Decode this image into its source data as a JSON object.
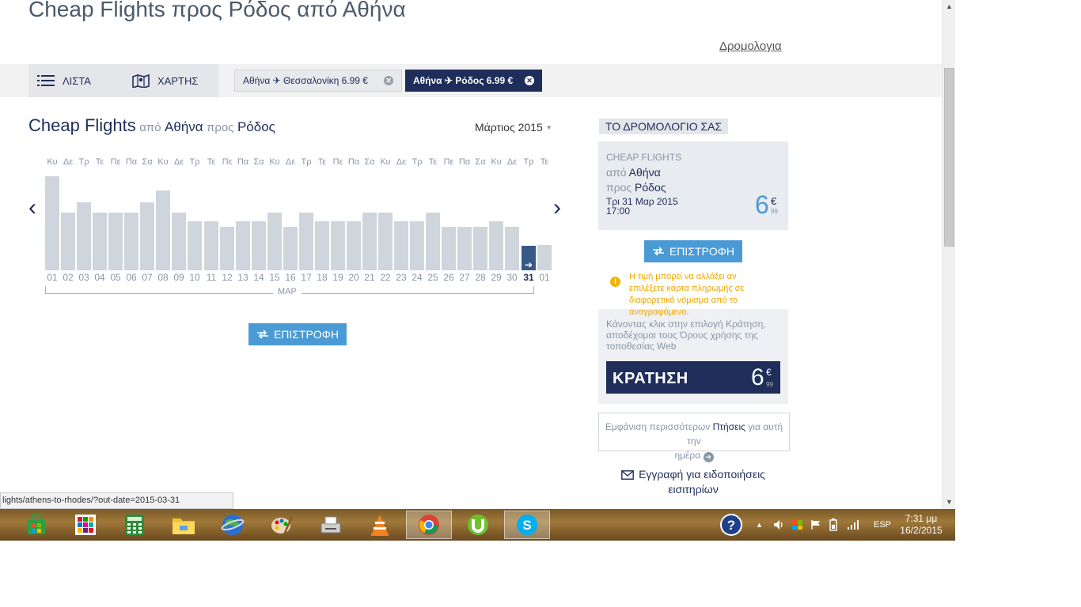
{
  "page": {
    "title": "Cheap Flights προς Ρόδος από Αθήνα",
    "itinerary_link": "Δρομολογια"
  },
  "view_toggle": {
    "list_label": "ΛΙΣΤΑ",
    "map_label": "ΧΑΡΤΗΣ"
  },
  "search_tabs": [
    {
      "label": "Αθήνα ✈ Θεσσαλονίκη 6.99 €",
      "active": false
    },
    {
      "label": "Αθήνα ✈ Ρόδος 6.99 €",
      "active": true
    }
  ],
  "calendar": {
    "title": "Cheap Flights",
    "from_prefix": "από",
    "from_city": "Αθήνα",
    "to_prefix": "προς",
    "to_city": "Ρόδος",
    "month_select": "Μάρτιος 2015",
    "month_label": "ΜΑΡ",
    "prev_arrow": "‹",
    "next_arrow": "›",
    "return_button": "ΕΠΙΣΤΡΟΦΗ",
    "selected_index": 30,
    "selected_arrow": "➔",
    "day_labels": [
      "Κυ",
      "Δε",
      "Τρ",
      "Τε",
      "Πε",
      "Πα",
      "Σα",
      "Κυ",
      "Δε",
      "Τρ",
      "Τε",
      "Πε",
      "Πα",
      "Σα",
      "Κυ",
      "Δε",
      "Τρ",
      "Τε",
      "Πε",
      "Πα",
      "Σα",
      "Κυ",
      "Δε",
      "Τρ",
      "Τε",
      "Πε",
      "Πα",
      "Σα",
      "Κυ",
      "Δε",
      "Τρ",
      "Τε"
    ],
    "dates": [
      "01",
      "02",
      "03",
      "04",
      "05",
      "06",
      "07",
      "08",
      "09",
      "10",
      "11",
      "12",
      "13",
      "14",
      "15",
      "16",
      "17",
      "18",
      "19",
      "20",
      "21",
      "22",
      "23",
      "24",
      "25",
      "26",
      "27",
      "28",
      "29",
      "30",
      "31",
      "01"
    ],
    "price_levels": [
      1.0,
      0.61,
      0.72,
      0.61,
      0.61,
      0.61,
      0.72,
      0.85,
      0.61,
      0.52,
      0.52,
      0.46,
      0.52,
      0.52,
      0.61,
      0.46,
      0.61,
      0.52,
      0.52,
      0.52,
      0.61,
      0.61,
      0.52,
      0.52,
      0.61,
      0.46,
      0.46,
      0.46,
      0.52,
      0.46,
      0.26,
      0.27
    ]
  },
  "itinerary": {
    "header": "ΤΟ ΔΡΟΜΟΛΟΓΙΟ ΣΑΣ",
    "label": "CHEAP FLIGHTS",
    "from_prefix": "από",
    "from_city": "Αθήνα",
    "to_prefix": "προς",
    "to_city": "Ρόδος",
    "date": "Τρι 31 Μαρ 2015",
    "time": "17:00",
    "price_int": "6",
    "price_cur": "€",
    "price_dec": "99",
    "return_button": "ΕΠΙΣΤΡΟΦΗ",
    "warning_icon": "i",
    "warning": "Η τιμή μπορεί να αλλάξει αν επιλέξετε κάρτα πληρωμής σε διαφορετικό νόμισμα από το αναγραφόμενο.",
    "terms": "Κάνοντας κλικ στην επιλογή Κράτηση, αποδέχομαι τους Όρους χρήσης της τοποθεσίας Web",
    "book_label": "ΚΡΑΤΗΣΗ",
    "more_prefix": "Εμφάνιση περισσότερων",
    "more_strong": "Πτήσεις",
    "more_suffix": "για αυτή την",
    "more_line2": "ημέρα",
    "more_go": "➔",
    "alerts": "Εγγραφή για ειδοποιήσεις εισιτηρίων"
  },
  "browser": {
    "status_url": "lights/athens-to-rhodes/?out-date=2015-03-31",
    "scroll_up": "▲",
    "scroll_down": "▼"
  },
  "taskbar": {
    "apps": [
      "store-icon",
      "metro-apps-icon",
      "calculator-icon",
      "file-explorer-icon",
      "google-earth-icon",
      "paint-icon",
      "fax-scan-icon",
      "vlc-icon",
      "chrome-icon",
      "utorrent-icon",
      "skype-icon"
    ],
    "help_glyph": "?",
    "tray_expand": "▲",
    "language": "ESP",
    "time": "7:31 μμ",
    "date": "16/2/2015",
    "colors": {
      "chrome_red": "#db4437",
      "skype_blue": "#00aff0",
      "utorrent_green": "#6fbf2f",
      "vlc_orange": "#f58220"
    }
  },
  "colors": {
    "navy": "#1f2d5a",
    "accent_blue": "#4a9ad6",
    "bar_default": "#cfd5dc",
    "bar_selected": "#37598a",
    "warning": "#f0a800"
  }
}
